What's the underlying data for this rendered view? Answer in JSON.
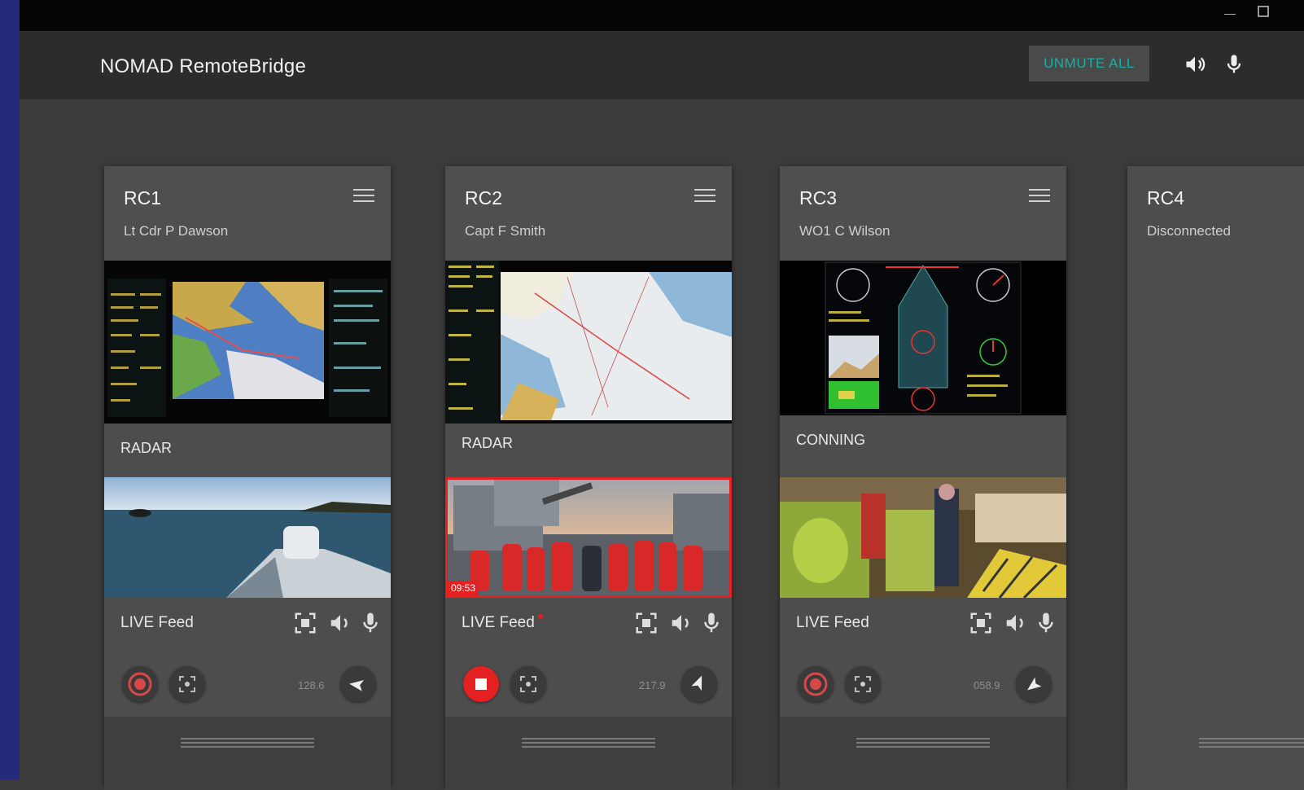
{
  "app": {
    "title": "NOMAD RemoteBridge"
  },
  "window": {
    "minimize_icon": "minimize-icon",
    "maximize_icon": "maximize-icon"
  },
  "header": {
    "unmute_all_label": "UNMUTE ALL",
    "speaker_icon": "speaker-icon",
    "mic_icon": "microphone-icon"
  },
  "colors": {
    "accent": "#17b0a3",
    "record": "#e52020",
    "background": "#3b3b3b",
    "card": "#4d4d4d",
    "left_strip": "#252a7a"
  },
  "cards": [
    {
      "name": "RC1",
      "user": "Lt Cdr P Dawson",
      "source": "RADAR",
      "feed": "LIVE Feed",
      "heading": "128.6",
      "recording": false
    },
    {
      "name": "RC2",
      "user": "Capt F Smith",
      "source": "RADAR",
      "feed": "LIVE Feed",
      "heading": "217.9",
      "recording": true,
      "timer": "09:53"
    },
    {
      "name": "RC3",
      "user": "WO1 C Wilson",
      "source": "CONNING",
      "feed": "LIVE Feed",
      "heading": "058.9",
      "recording": false
    },
    {
      "name": "RC4",
      "user": "Disconnected"
    }
  ]
}
